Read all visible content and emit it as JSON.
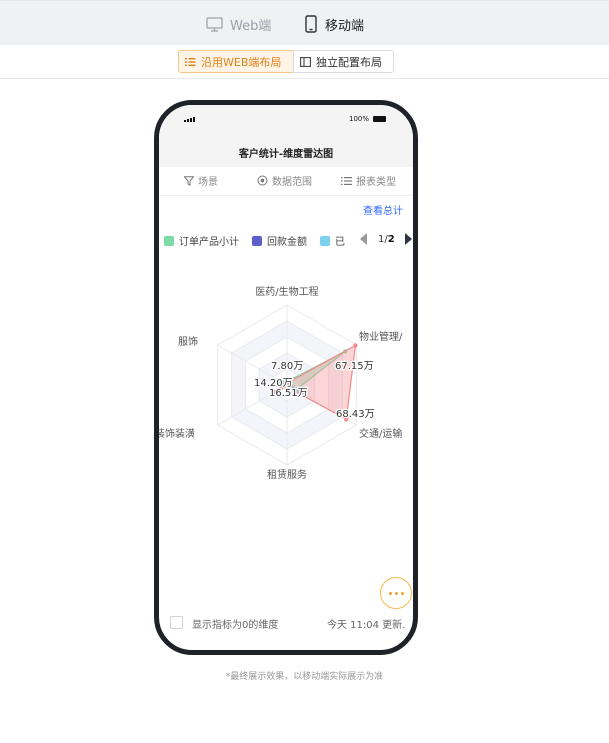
{
  "topbar": {
    "tabs": [
      {
        "label": "Web端",
        "icon": "monitor-icon",
        "active": false
      },
      {
        "label": "移动端",
        "icon": "mobile-icon",
        "active": true
      }
    ]
  },
  "layout_switch": {
    "options": [
      {
        "label": "沿用WEB端布局",
        "icon": "list-icon",
        "selected": true
      },
      {
        "label": "独立配置布局",
        "icon": "panel-icon",
        "selected": false
      }
    ]
  },
  "phone": {
    "status": {
      "battery": "100%"
    },
    "title": "客户统计-维度雷达图",
    "filters": [
      {
        "label": "场景",
        "icon": "filter-icon"
      },
      {
        "label": "数据范围",
        "icon": "target-icon"
      },
      {
        "label": "报表类型",
        "icon": "list-icon"
      }
    ],
    "view_total": "查看总计",
    "legend": {
      "items": [
        {
          "label": "订单产品小计",
          "color": "#7ddba8"
        },
        {
          "label": "回款金额",
          "color": "#5b5fc7"
        },
        {
          "label": "已",
          "color": "#7cd1ef"
        }
      ],
      "page_current": "1",
      "page_sep": "/",
      "page_total": "2"
    },
    "show_zero_label": "显示指标为0的维度",
    "updated_text": "今天 11:04 更新."
  },
  "chart_data": {
    "type": "radar",
    "dimensions": [
      "医药/生物工程",
      "物业管理/",
      "交通/运输",
      "租赁服务",
      "/装饰装潢",
      "服饰"
    ],
    "dimension_labels_visible": [
      "医药/生物工程",
      "物业管理/",
      "交通/运输",
      "租赁服务",
      "/装饰装潢",
      "服饰"
    ],
    "series": [
      {
        "name": "订单产品小计",
        "color": "#7ddba8",
        "values": [
          3.5,
          67.15,
          10,
          2,
          3,
          7.8
        ]
      },
      {
        "name": "回款金额",
        "color": "#5b5fc7",
        "values": [
          2,
          2,
          2,
          4,
          2,
          2
        ]
      },
      {
        "name": "已",
        "color": "#7cd1ef",
        "values": [
          2,
          3,
          16.51,
          6,
          2,
          3
        ]
      },
      {
        "color": "#f58a8a",
        "values": [
          2,
          79,
          68.43,
          2,
          14.2,
          2
        ]
      }
    ],
    "data_labels": [
      "67.15万",
      "7.80万",
      "14.20万",
      "16.51万",
      "68.43万"
    ],
    "rmax": 80,
    "rings": 5,
    "legend_position": "top"
  },
  "footnote": "*最终展示效果，以移动端实际展示为准"
}
